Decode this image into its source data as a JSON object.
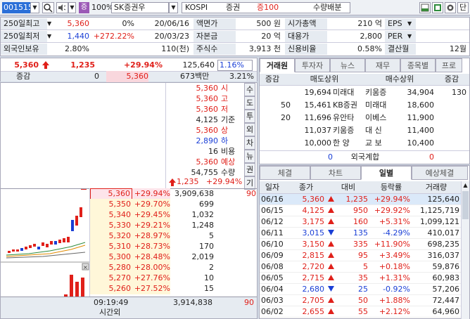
{
  "toolbar": {
    "code": "001515",
    "name": "SK증권우",
    "badge": "증",
    "pct": "100%",
    "market": "KOSPI",
    "market_type": "증권",
    "margin": "증100",
    "tag": "수량배분",
    "end_button": "단"
  },
  "info": {
    "rows": [
      {
        "k1": "250일최고",
        "v1": "5,360",
        "v2": "0%",
        "v3": "20/06/16",
        "k2": "액면가",
        "v4": "500 원",
        "k3": "시가총액",
        "v5": "210 억",
        "k4": "EPS",
        "v6": ""
      },
      {
        "k1": "250일최저",
        "v1": "1,440",
        "v2": "+272.22%",
        "v3": "20/03/23",
        "k2": "자본금",
        "v4": "20 억",
        "k3": "대용가",
        "v5": "2,800",
        "k4": "PER",
        "v6": ""
      },
      {
        "k1": "외국인보유",
        "v1": "2.80%",
        "v2": "",
        "v3": "110(천)",
        "k2": "주식수",
        "v4": "3,913 천",
        "k3": "신용비율",
        "v5": "0.58%",
        "k4": "결산월",
        "v6": "12월"
      }
    ]
  },
  "price": {
    "last": "5,360",
    "change": "1,235",
    "rate": "+29.94%",
    "volume": "125,640",
    "turnover": "1.16%",
    "gap_label": "증감",
    "gap1": "0",
    "gap2": "5,360",
    "amount": "673백만",
    "ratio": "3.21%"
  },
  "orderbook": {
    "summary": [
      {
        "p": "5,360",
        "l": "시",
        "c": "red"
      },
      {
        "p": "5,360",
        "l": "고",
        "c": "red"
      },
      {
        "p": "5,360",
        "l": "저",
        "c": "red"
      },
      {
        "p": "4,125",
        "l": "기준",
        "c": "blk"
      },
      {
        "p": "5,360",
        "l": "상",
        "c": "red"
      },
      {
        "p": "2,890",
        "l": "하",
        "c": "blue"
      },
      {
        "p": "16",
        "l": "비용",
        "c": "blk"
      },
      {
        "p": "5,360",
        "l": "예상",
        "c": "red"
      },
      {
        "p": "54,755",
        "l": "수량",
        "c": "blk"
      }
    ],
    "exp_change": "1,235",
    "exp_rate": "+29.94%",
    "side_tabs": [
      "수",
      "도",
      "투",
      "외",
      "차",
      "뉴",
      "권",
      "기"
    ],
    "bids": [
      {
        "p": "5,360",
        "r": "+29.94%",
        "q": "3,909,638",
        "x": "90"
      },
      {
        "p": "5,350",
        "r": "+29.70%",
        "q": "699",
        "x": ""
      },
      {
        "p": "5,340",
        "r": "+29.45%",
        "q": "1,032",
        "x": ""
      },
      {
        "p": "5,330",
        "r": "+29.21%",
        "q": "1,248",
        "x": ""
      },
      {
        "p": "5,320",
        "r": "+28.97%",
        "q": "5",
        "x": ""
      },
      {
        "p": "5,310",
        "r": "+28.73%",
        "q": "170",
        "x": ""
      },
      {
        "p": "5,300",
        "r": "+28.48%",
        "q": "2,019",
        "x": ""
      },
      {
        "p": "5,280",
        "r": "+28.00%",
        "q": "2",
        "x": ""
      },
      {
        "p": "5,270",
        "r": "+27.76%",
        "q": "10",
        "x": ""
      },
      {
        "p": "5,260",
        "r": "+27.52%",
        "q": "15",
        "x": ""
      }
    ],
    "time": "09:19:49",
    "time_label": "시간외",
    "total": "3,914,838",
    "total_x": "90"
  },
  "broker": {
    "tabs": [
      "거래원",
      "투자자",
      "뉴스",
      "재무",
      "종목별",
      "프로"
    ],
    "headers": [
      "증감",
      "매도상위",
      "매수상위",
      "증감"
    ],
    "rows": [
      {
        "a": "",
        "b": "19,694",
        "n1": "미래대",
        "n2": "키움증",
        "c": "34,904",
        "d": "130"
      },
      {
        "a": "50",
        "b": "15,461",
        "n1": "KB증권",
        "n2": "미래대",
        "c": "18,600",
        "d": ""
      },
      {
        "a": "20",
        "b": "11,696",
        "n1": "유안타",
        "n2": "이베스",
        "c": "11,900",
        "d": ""
      },
      {
        "a": "",
        "b": "11,037",
        "n1": "키움증",
        "n2": "대 신",
        "c": "11,400",
        "d": ""
      },
      {
        "a": "",
        "b": "10,000",
        "n1": "한 양",
        "n2": "교 보",
        "c": "10,400",
        "d": ""
      }
    ],
    "foreign_label": "외국계합",
    "foreign_l": "0",
    "foreign_r": "0"
  },
  "daily": {
    "tabs": [
      "체결",
      "차트",
      "일별",
      "예상체결"
    ],
    "headers": [
      "일자",
      "종가",
      "대비",
      "등락률",
      "거래량"
    ],
    "rows": [
      {
        "d": "06/16",
        "p": "5,360",
        "dir": "up",
        "c": "1,235",
        "r": "+29.94%",
        "v": "125,640"
      },
      {
        "d": "06/15",
        "p": "4,125",
        "dir": "up",
        "c": "950",
        "r": "+29.92%",
        "v": "1,125,719"
      },
      {
        "d": "06/12",
        "p": "3,175",
        "dir": "up",
        "c": "160",
        "r": "+5.31%",
        "v": "1,099,121"
      },
      {
        "d": "06/11",
        "p": "3,015",
        "dir": "down",
        "c": "135",
        "r": "-4.29%",
        "v": "410,017"
      },
      {
        "d": "06/10",
        "p": "3,150",
        "dir": "up",
        "c": "335",
        "r": "+11.90%",
        "v": "698,235"
      },
      {
        "d": "06/09",
        "p": "2,815",
        "dir": "up",
        "c": "95",
        "r": "+3.49%",
        "v": "316,037"
      },
      {
        "d": "06/08",
        "p": "2,720",
        "dir": "up",
        "c": "5",
        "r": "+0.18%",
        "v": "59,876"
      },
      {
        "d": "06/05",
        "p": "2,715",
        "dir": "up",
        "c": "35",
        "r": "+1.31%",
        "v": "60,983"
      },
      {
        "d": "06/04",
        "p": "2,680",
        "dir": "down",
        "c": "25",
        "r": "-0.92%",
        "v": "57,206"
      },
      {
        "d": "06/03",
        "p": "2,705",
        "dir": "up",
        "c": "50",
        "r": "+1.88%",
        "v": "72,447"
      },
      {
        "d": "06/02",
        "p": "2,655",
        "dir": "up",
        "c": "55",
        "r": "+2.12%",
        "v": "64,960"
      }
    ]
  },
  "colors": {
    "up": "#e0201a",
    "down": "#1a3fd6",
    "accent": "#2a6fd8"
  },
  "icons": [
    "search-icon",
    "speaker-icon",
    "dropdown-icon",
    "layout-icon",
    "excel-icon",
    "gear-icon"
  ]
}
